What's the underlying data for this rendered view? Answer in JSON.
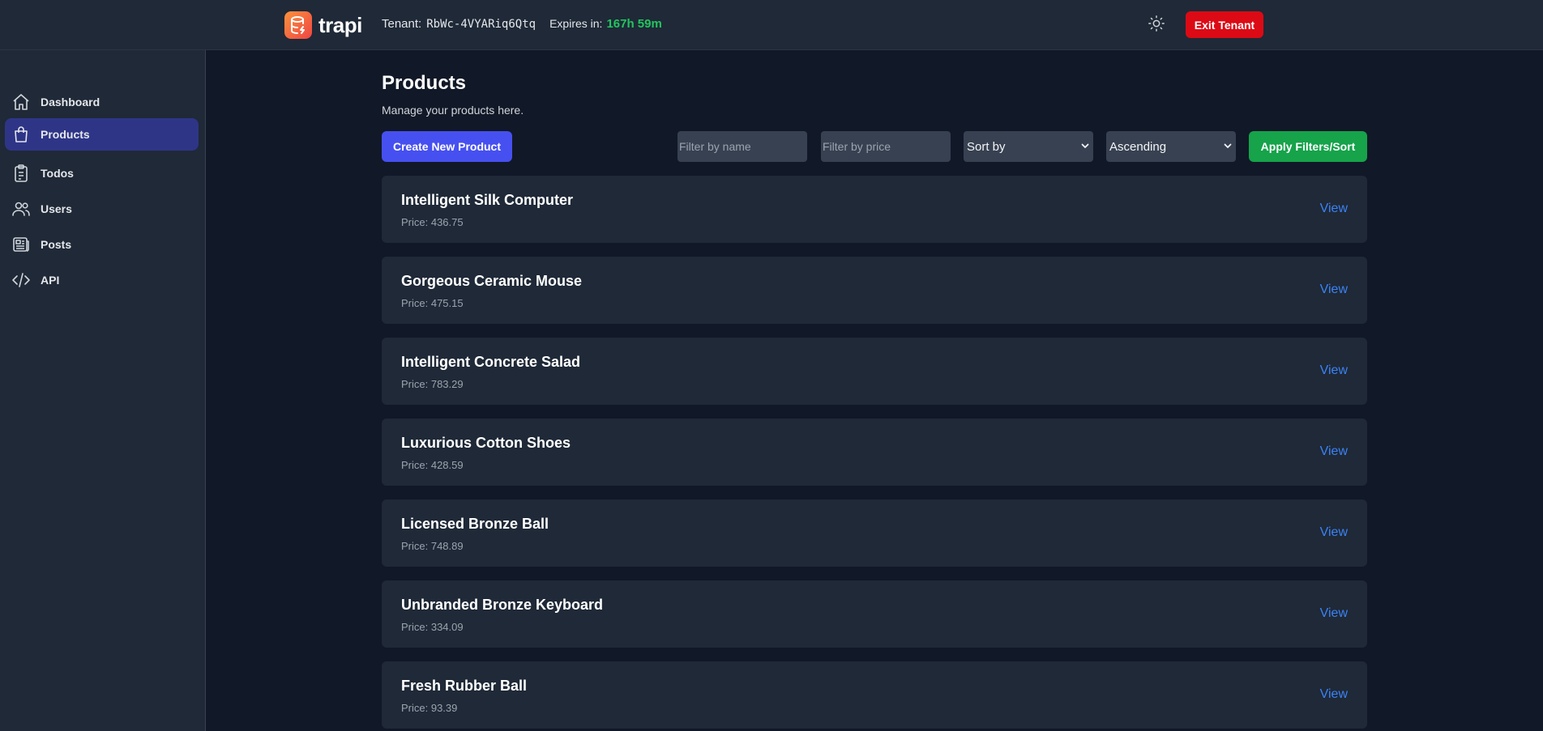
{
  "header": {
    "logo_text": "trapi",
    "tenant_label": "Tenant:",
    "tenant_id": "RbWc-4VYARiq6Qtq",
    "expires_label": "Expires in:",
    "expires_value": "167h 59m",
    "exit_label": "Exit Tenant",
    "theme_icon": "sun-icon"
  },
  "sidebar": {
    "items": [
      {
        "label": "Dashboard",
        "icon": "home-icon",
        "active": false
      },
      {
        "label": "Products",
        "icon": "shopping-bag-icon",
        "active": true
      },
      {
        "label": "Todos",
        "icon": "clipboard-icon",
        "active": false
      },
      {
        "label": "Users",
        "icon": "users-icon",
        "active": false
      },
      {
        "label": "Posts",
        "icon": "newspaper-icon",
        "active": false
      },
      {
        "label": "API",
        "icon": "code-icon",
        "active": false
      }
    ]
  },
  "main": {
    "title": "Products",
    "subtitle": "Manage your products here.",
    "create_label": "Create New Product",
    "filter_name_placeholder": "Filter by name",
    "filter_price_placeholder": "Filter by price",
    "sort_by_value": "Sort by",
    "order_value": "Ascending",
    "apply_label": "Apply Filters/Sort",
    "view_label": "View",
    "products": [
      {
        "name": "Intelligent Silk Computer",
        "price": "Price: 436.75"
      },
      {
        "name": "Gorgeous Ceramic Mouse",
        "price": "Price: 475.15"
      },
      {
        "name": "Intelligent Concrete Salad",
        "price": "Price: 783.29"
      },
      {
        "name": "Luxurious Cotton Shoes",
        "price": "Price: 428.59"
      },
      {
        "name": "Licensed Bronze Ball",
        "price": "Price: 748.89"
      },
      {
        "name": "Unbranded Bronze Keyboard",
        "price": "Price: 334.09"
      },
      {
        "name": "Fresh Rubber Ball",
        "price": "Price: 93.39"
      }
    ]
  },
  "colors": {
    "background": "#111827",
    "panel": "#1f2937",
    "accent": "#4650f0",
    "danger": "#dc0a15",
    "success": "#16a34a",
    "link": "#3b82f6",
    "timer": "#22c55e"
  }
}
